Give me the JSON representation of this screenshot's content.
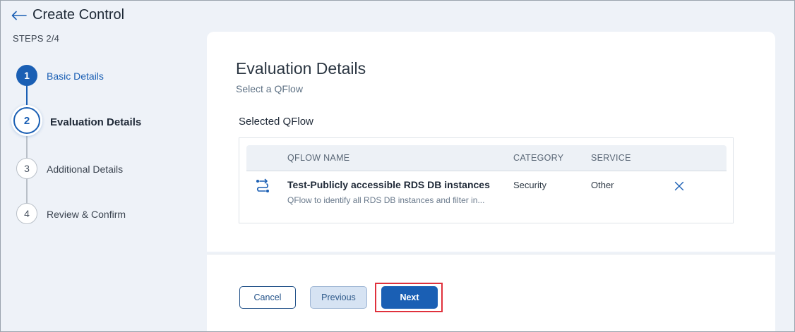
{
  "header": {
    "title": "Create Control",
    "steps_indicator": "STEPS 2/4"
  },
  "stepper": {
    "steps": [
      {
        "number": "1",
        "label": "Basic Details",
        "state": "completed"
      },
      {
        "number": "2",
        "label": "Evaluation Details",
        "state": "active"
      },
      {
        "number": "3",
        "label": "Additional Details",
        "state": "pending"
      },
      {
        "number": "4",
        "label": "Review & Confirm",
        "state": "pending"
      }
    ]
  },
  "main": {
    "title": "Evaluation Details",
    "subtitle": "Select a QFlow",
    "selected_label": "Selected QFlow",
    "table": {
      "columns": [
        "QFLOW NAME",
        "CATEGORY",
        "SERVICE"
      ],
      "rows": [
        {
          "icon": "qflow-icon",
          "name": "Test-Publicly accessible RDS DB instances",
          "description": "QFlow to identify all RDS DB instances and filter in...",
          "category": "Security",
          "service": "Other"
        }
      ]
    }
  },
  "footer": {
    "cancel_label": "Cancel",
    "previous_label": "Previous",
    "next_label": "Next"
  },
  "colors": {
    "accent": "#1a5fb4",
    "highlight": "#e0313c",
    "background": "#eef2f8"
  }
}
